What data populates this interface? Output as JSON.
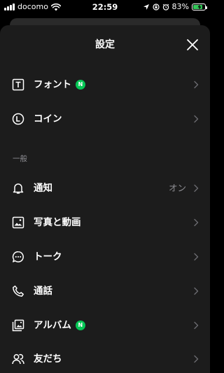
{
  "status_bar": {
    "carrier": "docomo",
    "time": "22:59",
    "battery_percent": "83%",
    "battery_level": 0.83
  },
  "settings": {
    "title": "設定",
    "items_top": [
      {
        "label": "フォント",
        "icon": "font-icon",
        "badge": "N"
      },
      {
        "label": "コイン",
        "icon": "coin-icon"
      }
    ],
    "general_section_label": "一般",
    "items_general": [
      {
        "label": "通知",
        "icon": "bell-icon",
        "value": "オン"
      },
      {
        "label": "写真と動画",
        "icon": "photo-icon"
      },
      {
        "label": "トーク",
        "icon": "chat-bubble-icon"
      },
      {
        "label": "通話",
        "icon": "phone-icon"
      },
      {
        "label": "アルバム",
        "icon": "album-icon",
        "badge": "N"
      },
      {
        "label": "友だち",
        "icon": "friends-icon"
      }
    ]
  },
  "colors": {
    "background": "#1c1c1c",
    "badge_green": "#06c755",
    "secondary_text": "#8e8e93"
  }
}
